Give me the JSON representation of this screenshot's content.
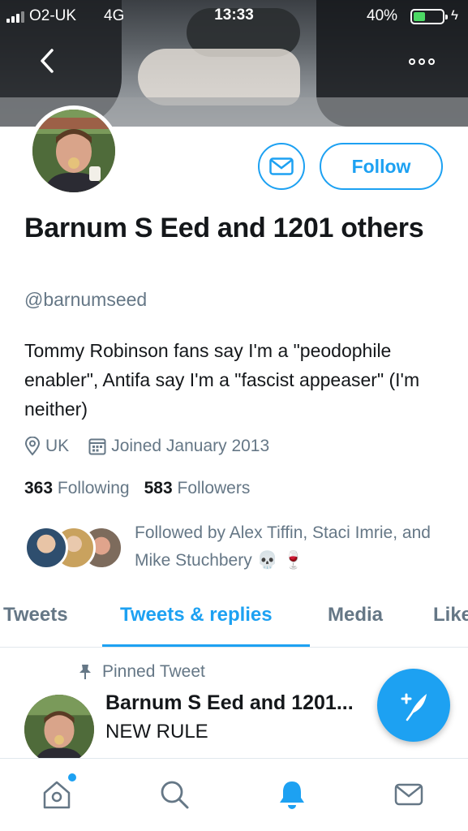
{
  "status_bar": {
    "carrier": "O2-UK",
    "network": "4G",
    "time": "13:33",
    "battery": "40%",
    "battery_level": 0.4
  },
  "profile": {
    "name": "Barnum S Eed and 1201 others",
    "handle": "@barnumseed",
    "bio": "Tommy Robinson fans say I'm a \"peodophile enabler\", Antifa say I'm a \"fascist appeaser\" (I'm neither)",
    "location": "UK",
    "joined": "Joined January 2013",
    "following_count": "363",
    "following_label": "Following",
    "followers_count": "583",
    "followers_label": "Followers",
    "followed_by": "Followed by Alex Tiffin, Staci Imrie, and Mike Stuchbery 💀 🍷",
    "follow_label": "Follow"
  },
  "tabs": [
    {
      "label": "Tweets",
      "active": false
    },
    {
      "label": "Tweets & replies",
      "active": true
    },
    {
      "label": "Media",
      "active": false
    },
    {
      "label": "Likes",
      "active": false
    }
  ],
  "pinned_tweet": {
    "pinned_label": "Pinned Tweet",
    "author": "Barnum S Eed and 1201...",
    "text": "NEW RULE"
  },
  "bottom_nav": [
    {
      "icon": "home-icon",
      "active": false,
      "badge": true
    },
    {
      "icon": "search-icon",
      "active": false,
      "badge": false
    },
    {
      "icon": "notifications-icon",
      "active": true,
      "badge": false
    },
    {
      "icon": "messages-icon",
      "active": false,
      "badge": false
    }
  ],
  "colors": {
    "accent": "#1da1f2",
    "text": "#14171a",
    "secondary_text": "#657786"
  }
}
